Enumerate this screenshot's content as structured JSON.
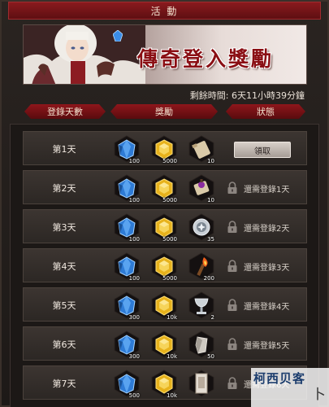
{
  "window": {
    "title": "活 動"
  },
  "banner": {
    "title": "傳奇登入獎勵"
  },
  "timer": {
    "text": "剩餘時間: 6天11小時39分鐘"
  },
  "columns": {
    "day": "登錄天數",
    "reward": "獎勵",
    "status": "狀態"
  },
  "rows": [
    {
      "day": "第1天",
      "r1": "100",
      "r2": "5000",
      "r3": "10",
      "r3_icon": "scroll-icon",
      "status": "領取",
      "claimable": true
    },
    {
      "day": "第2天",
      "r1": "100",
      "r2": "5000",
      "r3": "10",
      "r3_icon": "potion-scroll-icon",
      "status": "還需登錄1天",
      "claimable": false
    },
    {
      "day": "第3天",
      "r1": "100",
      "r2": "5000",
      "r3": "35",
      "r3_icon": "medal-icon",
      "status": "還需登錄2天",
      "claimable": false
    },
    {
      "day": "第4天",
      "r1": "100",
      "r2": "5000",
      "r3": "200",
      "r3_icon": "torch-icon",
      "status": "還需登錄3天",
      "claimable": false
    },
    {
      "day": "第5天",
      "r1": "300",
      "r2": "10k",
      "r3": "2",
      "r3_icon": "chalice-icon",
      "status": "還需登錄4天",
      "claimable": false
    },
    {
      "day": "第6天",
      "r1": "300",
      "r2": "10k",
      "r3": "50",
      "r3_icon": "stone-shard-icon",
      "status": "還需登錄5天",
      "claimable": false
    },
    {
      "day": "第7天",
      "r1": "500",
      "r2": "10k",
      "r3": "",
      "r3_icon": "banner-card-icon",
      "status": "還需登錄6天",
      "claimable": false
    }
  ],
  "watermark": {
    "text": "柯西贝客",
    "sub": "卜"
  },
  "colors": {
    "accent": "#8a1a1e",
    "gem": "#2e7bd6",
    "gold": "#e7b21c"
  }
}
